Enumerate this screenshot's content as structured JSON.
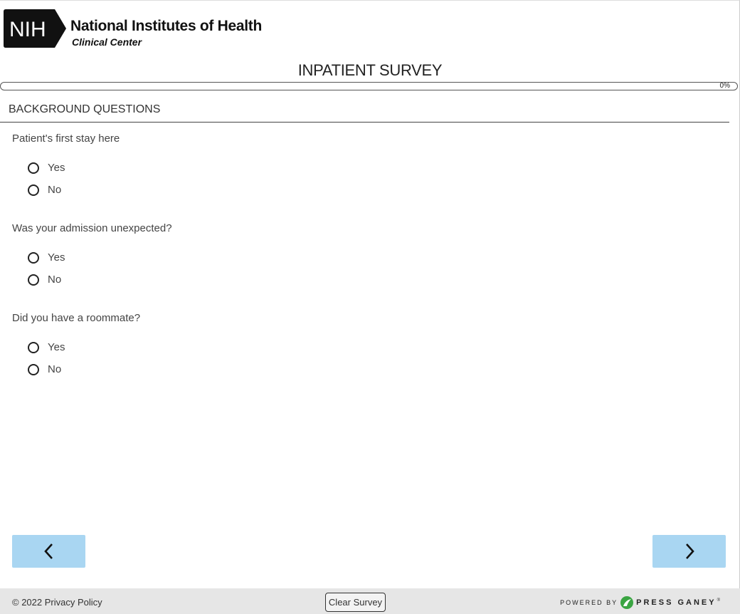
{
  "header": {
    "logo_abbr": "NIH",
    "org_name": "National Institutes of Health",
    "org_sub": "Clinical Center",
    "survey_title": "INPATIENT SURVEY"
  },
  "progress": {
    "value": 0,
    "label": "0%"
  },
  "section": {
    "title": "BACKGROUND QUESTIONS"
  },
  "questions": [
    {
      "text": "Patient's first stay here",
      "options": [
        "Yes",
        "No"
      ]
    },
    {
      "text": "Was your admission unexpected?",
      "options": [
        "Yes",
        "No"
      ]
    },
    {
      "text": "Did you have a roommate?",
      "options": [
        "Yes",
        "No"
      ]
    }
  ],
  "nav": {
    "back_icon": "chevron-left-icon",
    "next_icon": "chevron-right-icon"
  },
  "footer": {
    "copyright": "© 2022 Privacy Policy",
    "clear_label": "Clear Survey",
    "powered_by": "POWERED BY",
    "vendor": "PRESS GANEY",
    "trademark": "®"
  },
  "colors": {
    "nav_button": "#a9d6f2",
    "footer_bg": "#e6e6e6",
    "vendor_green": "#3aa542"
  }
}
